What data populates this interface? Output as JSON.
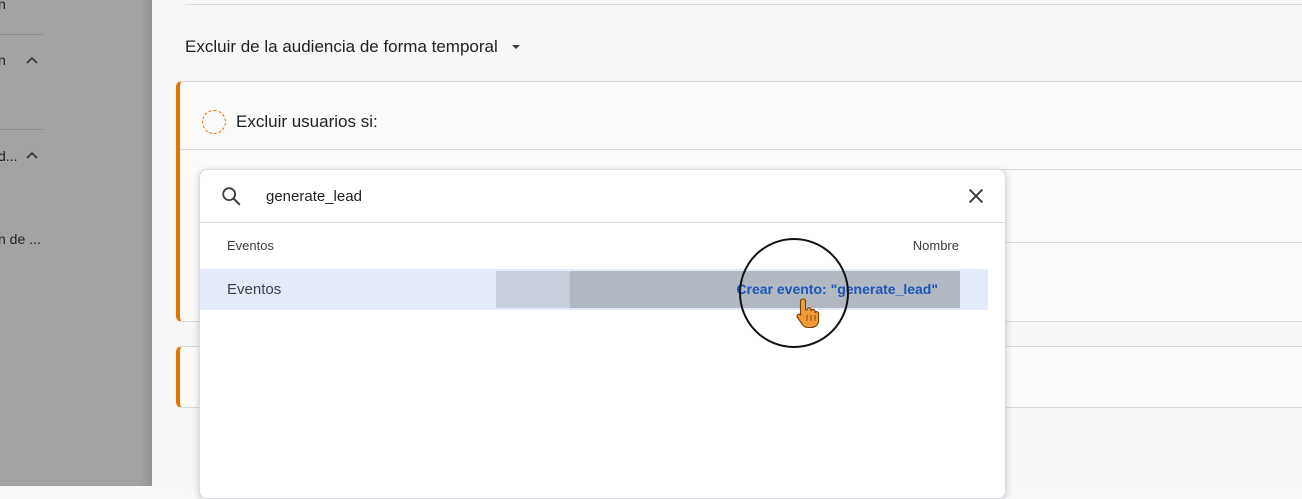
{
  "sidebar": {
    "items": [
      {
        "label": "n"
      },
      {
        "label": "n"
      },
      {
        "label": "d..."
      },
      {
        "label": "n de ..."
      }
    ]
  },
  "main": {
    "dropdown_title": "Excluir de la audiencia de forma temporal",
    "card_header": "Excluir usuarios si:"
  },
  "popup": {
    "search_value": "generate_lead",
    "column_left": "Eventos",
    "column_right": "Nombre",
    "result_label": "Eventos",
    "create_action": "Crear evento: \"generate_lead\""
  },
  "colors": {
    "accent_orange": "#e37400",
    "link_blue": "#1a56b8",
    "row_highlight": "#e3ebfa"
  },
  "icons": [
    "search-icon",
    "close-icon",
    "chevron-up-icon",
    "caret-down-icon",
    "hand-pointer-icon"
  ]
}
